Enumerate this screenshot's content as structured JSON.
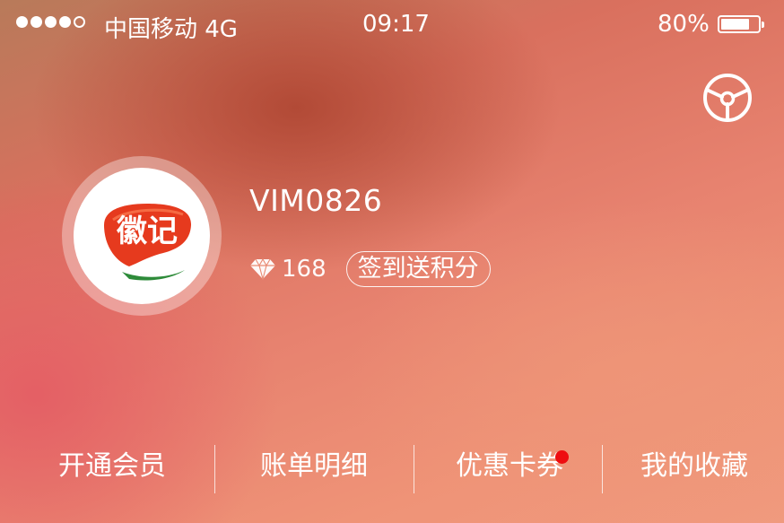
{
  "status_bar": {
    "signal_dots": 5,
    "carrier": "中国移动 4G",
    "time": "09:17",
    "battery_percent": "80%",
    "battery_level": 0.8
  },
  "header": {
    "settings_icon": "steering-wheel-settings-icon"
  },
  "profile": {
    "avatar_logo_text": "徽记",
    "username": "VIM0826",
    "points_icon": "diamond-icon",
    "points": "168",
    "checkin_button": "签到送积分"
  },
  "menu": {
    "items": [
      {
        "label": "开通会员",
        "badge": false
      },
      {
        "label": "账单明细",
        "badge": false
      },
      {
        "label": "优惠卡券",
        "badge": true
      },
      {
        "label": "我的收藏",
        "badge": false
      }
    ]
  },
  "colors": {
    "badge": "#ee0d10",
    "logo_red": "#e63a1e",
    "logo_green": "#2e8b3a"
  }
}
